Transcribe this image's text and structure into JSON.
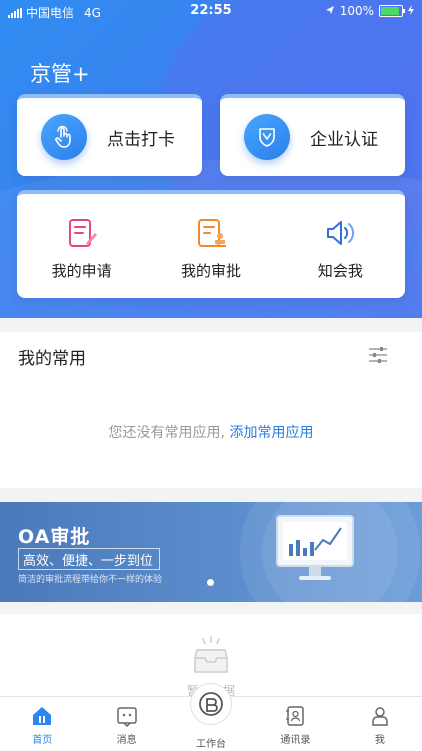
{
  "status_bar": {
    "carrier": "中国电信",
    "network": "4G",
    "time": "22:55",
    "battery": "100%",
    "battery_level": 1.0
  },
  "app": {
    "title": "京管+"
  },
  "actions": {
    "clock_in": "点击打卡",
    "certify": "企业认证"
  },
  "quick": {
    "items": [
      {
        "label": "我的申请",
        "icon": "application-form-icon"
      },
      {
        "label": "我的审批",
        "icon": "approval-stamp-icon"
      },
      {
        "label": "知会我",
        "icon": "speaker-icon"
      }
    ]
  },
  "favorites": {
    "title": "我的常用",
    "empty_text": "您还没有常用应用,",
    "add_link": "添加常用应用"
  },
  "banner": {
    "title": "OA审批",
    "subtitle": "高效、便捷、一步到位",
    "desc": "简洁的审批流程带给你不一样的体验"
  },
  "news": {
    "caption": "暂无数据"
  },
  "tabs": [
    {
      "label": "首页",
      "active": true
    },
    {
      "label": "消息",
      "active": false
    },
    {
      "label": "工作台",
      "active": false
    },
    {
      "label": "通讯录",
      "active": false
    },
    {
      "label": "我",
      "active": false
    }
  ],
  "colors": {
    "primary": "#2f8df2",
    "link": "#2a7be4",
    "banner": "#4b79b9"
  }
}
